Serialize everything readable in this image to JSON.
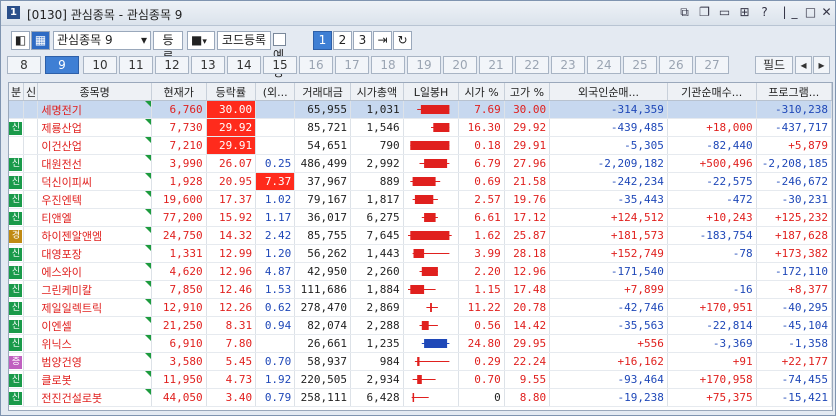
{
  "window": {
    "title": "[0130] 관심종목 - 관심종목 9",
    "app_badge": "1"
  },
  "toolbar": {
    "group_select": "관심종목 9",
    "register_label": "등록",
    "code_register_label": "코드등록",
    "forecast_label": "예상",
    "pages": [
      "1",
      "2",
      "3"
    ],
    "selected_page": "1"
  },
  "tabs": [
    "8",
    "9",
    "10",
    "11",
    "12",
    "13",
    "14",
    "15",
    "16",
    "17",
    "18",
    "19",
    "20",
    "21",
    "22",
    "23",
    "24",
    "25",
    "26",
    "27"
  ],
  "selected_tab": "9",
  "filter_label": "필드",
  "columns": [
    "분",
    "신",
    "종목명",
    "현재가",
    "등락률",
    "(외...",
    "거래대금",
    "시가총액",
    "L일봉H",
    "시가 %",
    "고가 %",
    "외국인순매...",
    "기관순매수...",
    "프로그램..."
  ],
  "rows": [
    {
      "cat": "",
      "sin": "",
      "name": "세명전기",
      "price": "6,760",
      "rate": "30.00",
      "foreign": "",
      "value": "65,955",
      "cap": "1,031",
      "open": "7.69",
      "high": "30.00",
      "f_net": "-314,359",
      "i_net": "",
      "p_net": "-310,238",
      "dir": "up",
      "rate_hl": true,
      "for_hl": false,
      "sel": true
    },
    {
      "cat": "신",
      "sin": "",
      "name": "제룡산업",
      "price": "7,730",
      "rate": "29.92",
      "foreign": "",
      "value": "85,721",
      "cap": "1,546",
      "open": "16.30",
      "high": "29.92",
      "f_net": "-439,485",
      "i_net": "+18,000",
      "p_net": "-437,717",
      "dir": "up",
      "rate_hl": true,
      "for_hl": false,
      "sel": false
    },
    {
      "cat": "",
      "sin": "",
      "name": "이건산업",
      "price": "7,210",
      "rate": "29.91",
      "foreign": "",
      "value": "54,651",
      "cap": "790",
      "open": "0.18",
      "high": "29.91",
      "f_net": "-5,305",
      "i_net": "-82,440",
      "p_net": "+5,879",
      "dir": "up",
      "rate_hl": true,
      "for_hl": false,
      "sel": false
    },
    {
      "cat": "신",
      "sin": "",
      "name": "대원전선",
      "price": "3,990",
      "rate": "26.07",
      "foreign": "0.25",
      "value": "486,499",
      "cap": "2,992",
      "open": "6.79",
      "high": "27.96",
      "f_net": "-2,209,182",
      "i_net": "+500,496",
      "p_net": "-2,208,185",
      "dir": "up",
      "rate_hl": false,
      "for_hl": false,
      "sel": false
    },
    {
      "cat": "신",
      "sin": "",
      "name": "덕신이피씨",
      "price": "1,928",
      "rate": "20.95",
      "foreign": "7.37",
      "value": "37,967",
      "cap": "889",
      "open": "0.69",
      "high": "21.58",
      "f_net": "-242,234",
      "i_net": "-22,575",
      "p_net": "-246,672",
      "dir": "up",
      "rate_hl": false,
      "for_hl": true,
      "sel": false
    },
    {
      "cat": "신",
      "sin": "",
      "name": "우진엔텍",
      "price": "19,600",
      "rate": "17.37",
      "foreign": "1.02",
      "value": "79,167",
      "cap": "1,817",
      "open": "2.57",
      "high": "19.76",
      "f_net": "-35,443",
      "i_net": "-472",
      "p_net": "-30,231",
      "dir": "up",
      "rate_hl": false,
      "for_hl": false,
      "sel": false
    },
    {
      "cat": "신",
      "sin": "",
      "name": "티앤엘",
      "price": "77,200",
      "rate": "15.92",
      "foreign": "1.17",
      "value": "36,017",
      "cap": "6,275",
      "open": "6.61",
      "high": "17.12",
      "f_net": "+124,512",
      "i_net": "+10,243",
      "p_net": "+125,232",
      "dir": "up",
      "rate_hl": false,
      "for_hl": false,
      "sel": false
    },
    {
      "cat": "경",
      "sin": "",
      "name": "하이젠알앤엠",
      "price": "24,750",
      "rate": "14.32",
      "foreign": "2.42",
      "value": "85,755",
      "cap": "7,645",
      "open": "1.62",
      "high": "25.87",
      "f_net": "+181,573",
      "i_net": "-183,754",
      "p_net": "+187,628",
      "dir": "up",
      "rate_hl": false,
      "for_hl": false,
      "sel": false
    },
    {
      "cat": "신",
      "sin": "",
      "name": "대영포장",
      "price": "1,331",
      "rate": "12.99",
      "foreign": "1.20",
      "value": "56,262",
      "cap": "1,443",
      "open": "3.99",
      "high": "28.18",
      "f_net": "+152,749",
      "i_net": "-78",
      "p_net": "+173,382",
      "dir": "up",
      "rate_hl": false,
      "for_hl": false,
      "sel": false
    },
    {
      "cat": "신",
      "sin": "",
      "name": "에스와이",
      "price": "4,620",
      "rate": "12.96",
      "foreign": "4.87",
      "value": "42,950",
      "cap": "2,260",
      "open": "2.20",
      "high": "12.96",
      "f_net": "-171,540",
      "i_net": "",
      "p_net": "-172,110",
      "dir": "up",
      "rate_hl": false,
      "for_hl": false,
      "sel": false
    },
    {
      "cat": "신",
      "sin": "",
      "name": "그린케미칼",
      "price": "7,850",
      "rate": "12.46",
      "foreign": "1.53",
      "value": "111,686",
      "cap": "1,884",
      "open": "1.15",
      "high": "17.48",
      "f_net": "+7,899",
      "i_net": "-16",
      "p_net": "+8,377",
      "dir": "up",
      "rate_hl": false,
      "for_hl": false,
      "sel": false
    },
    {
      "cat": "신",
      "sin": "",
      "name": "제일일렉트릭",
      "price": "12,910",
      "rate": "12.26",
      "foreign": "0.62",
      "value": "278,470",
      "cap": "2,869",
      "open": "11.22",
      "high": "20.78",
      "f_net": "-42,746",
      "i_net": "+170,951",
      "p_net": "-40,295",
      "dir": "up",
      "rate_hl": false,
      "for_hl": false,
      "sel": false
    },
    {
      "cat": "신",
      "sin": "",
      "name": "이엔셀",
      "price": "21,250",
      "rate": "8.31",
      "foreign": "0.94",
      "value": "82,074",
      "cap": "2,288",
      "open": "0.56",
      "high": "14.42",
      "f_net": "-35,563",
      "i_net": "-22,814",
      "p_net": "-45,104",
      "dir": "up",
      "rate_hl": false,
      "for_hl": false,
      "sel": false
    },
    {
      "cat": "신",
      "sin": "",
      "name": "위닉스",
      "price": "6,910",
      "rate": "7.80",
      "foreign": "",
      "value": "26,661",
      "cap": "1,235",
      "open": "24.80",
      "high": "29.95",
      "f_net": "+556",
      "i_net": "-3,369",
      "p_net": "-1,358",
      "dir": "up",
      "rate_hl": false,
      "for_hl": false,
      "sel": false
    },
    {
      "cat": "증",
      "sin": "",
      "name": "범양건영",
      "price": "3,580",
      "rate": "5.45",
      "foreign": "0.70",
      "value": "58,937",
      "cap": "984",
      "open": "0.29",
      "high": "22.24",
      "f_net": "+16,162",
      "i_net": "+91",
      "p_net": "+22,177",
      "dir": "up",
      "rate_hl": false,
      "for_hl": false,
      "sel": false
    },
    {
      "cat": "신",
      "sin": "",
      "name": "클로봇",
      "price": "11,950",
      "rate": "4.73",
      "foreign": "1.92",
      "value": "220,505",
      "cap": "2,934",
      "open": "0.70",
      "high": "9.55",
      "f_net": "-93,464",
      "i_net": "+170,958",
      "p_net": "-74,455",
      "dir": "up",
      "rate_hl": false,
      "for_hl": false,
      "sel": false
    },
    {
      "cat": "신",
      "sin": "",
      "name": "전진건설로봇",
      "price": "44,050",
      "rate": "3.40",
      "foreign": "0.79",
      "value": "258,111",
      "cap": "6,428",
      "open": "0",
      "high": "8.80",
      "f_net": "-19,238",
      "i_net": "+75,375",
      "p_net": "-15,421",
      "dir": "up",
      "rate_hl": false,
      "for_hl": false,
      "sel": false
    }
  ],
  "candles": [
    {
      "body": [
        0.28,
        0.9
      ],
      "wick": [
        0.2,
        0.9
      ],
      "color": "red"
    },
    {
      "body": [
        0.55,
        0.9
      ],
      "wick": [
        0.5,
        0.9
      ],
      "color": "red"
    },
    {
      "body": [
        0.05,
        0.9
      ],
      "wick": [
        0.05,
        0.9
      ],
      "color": "red"
    },
    {
      "body": [
        0.35,
        0.85
      ],
      "wick": [
        0.25,
        0.9
      ],
      "color": "red"
    },
    {
      "body": [
        0.1,
        0.6
      ],
      "wick": [
        0.05,
        0.7
      ],
      "color": "red"
    },
    {
      "body": [
        0.15,
        0.55
      ],
      "wick": [
        0.1,
        0.65
      ],
      "color": "red"
    },
    {
      "body": [
        0.35,
        0.6
      ],
      "wick": [
        0.3,
        0.65
      ],
      "color": "red"
    },
    {
      "body": [
        0.05,
        0.9
      ],
      "wick": [
        0.0,
        0.95
      ],
      "color": "red"
    },
    {
      "body": [
        0.12,
        0.35
      ],
      "wick": [
        0.1,
        0.9
      ],
      "color": "red"
    },
    {
      "body": [
        0.3,
        0.65
      ],
      "wick": [
        0.25,
        0.65
      ],
      "color": "red"
    },
    {
      "body": [
        0.05,
        0.35
      ],
      "wick": [
        0.0,
        0.6
      ],
      "color": "red"
    },
    {
      "body": [
        0.48,
        0.52
      ],
      "wick": [
        0.4,
        0.65
      ],
      "color": "red"
    },
    {
      "body": [
        0.3,
        0.45
      ],
      "wick": [
        0.25,
        0.65
      ],
      "color": "red"
    },
    {
      "body": [
        0.35,
        0.85
      ],
      "wick": [
        0.3,
        0.9
      ],
      "color": "blue"
    },
    {
      "body": [
        0.2,
        0.25
      ],
      "wick": [
        0.15,
        0.9
      ],
      "color": "red"
    },
    {
      "body": [
        0.2,
        0.3
      ],
      "wick": [
        0.1,
        0.6
      ],
      "color": "red"
    },
    {
      "body": [
        0.1,
        0.12
      ],
      "wick": [
        0.08,
        0.45
      ],
      "color": "red"
    }
  ],
  "colors": {
    "up": "#e0201e",
    "down": "#1f48b8",
    "badge_new": "#1a9a4a",
    "badge_warn": "#c08a12",
    "badge_sec": "#c060c0",
    "accent": "#3f7fd4"
  }
}
